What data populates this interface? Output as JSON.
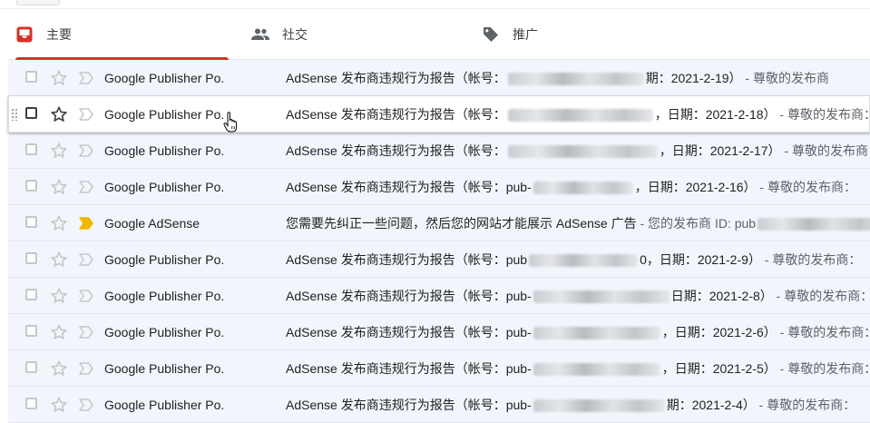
{
  "tabs": [
    {
      "label": "主要",
      "icon": "inbox-icon",
      "active": true
    },
    {
      "label": "社交",
      "icon": "people-icon",
      "active": false
    },
    {
      "label": "推广",
      "icon": "tag-icon",
      "active": false
    }
  ],
  "accent_color": "#d93025",
  "emails": [
    {
      "sender": "Google Publisher Po.",
      "subject_pre": "AdSense 发布商违规行为报告（帐号：",
      "subject_post": "期：2021-2-19）",
      "snippet": " - 尊敬的发布商"
    },
    {
      "sender": "Google Publisher Po.",
      "subject_pre": "AdSense 发布商违规行为报告（帐号：",
      "subject_post": "，日期：2021-2-18）",
      "snippet": " - 尊敬的发布商："
    },
    {
      "sender": "Google Publisher Po.",
      "subject_pre": "AdSense 发布商违规行为报告（帐号：",
      "subject_post": "，日期：2021-2-17）",
      "snippet": " - 尊敬的发布商："
    },
    {
      "sender": "Google Publisher Po.",
      "subject_pre": "AdSense 发布商违规行为报告（帐号：pub-",
      "subject_post": "，日期：2021-2-16）",
      "snippet": " - 尊敬的发布商："
    },
    {
      "sender": "Google AdSense",
      "subject_pre": "您需要先纠正一些问题，然后您的网站才能展示 AdSense 广告",
      "subject_post": "",
      "snippet": " - 您的发布商 ID: pub",
      "important": true
    },
    {
      "sender": "Google Publisher Po.",
      "subject_pre": "AdSense 发布商违规行为报告（帐号：pub",
      "subject_post": "0，日期：2021-2-9）",
      "snippet": " - 尊敬的发布商："
    },
    {
      "sender": "Google Publisher Po.",
      "subject_pre": "AdSense 发布商违规行为报告（帐号：pub-",
      "subject_post": "日期：2021-2-8）",
      "snippet": " - 尊敬的发布商："
    },
    {
      "sender": "Google Publisher Po.",
      "subject_pre": "AdSense 发布商违规行为报告（帐号：pub-",
      "subject_post": "，日期：2021-2-6）",
      "snippet": " - 尊敬的发布商："
    },
    {
      "sender": "Google Publisher Po.",
      "subject_pre": "AdSense 发布商违规行为报告（帐号：pub-",
      "subject_post": "，日期：2021-2-5）",
      "snippet": " - 尊敬的发布商："
    },
    {
      "sender": "Google Publisher Po.",
      "subject_pre": "AdSense 发布商违规行为报告（帐号：pub-",
      "subject_post": "期：2021-2-4）",
      "snippet": " - 尊敬的发布商："
    }
  ]
}
